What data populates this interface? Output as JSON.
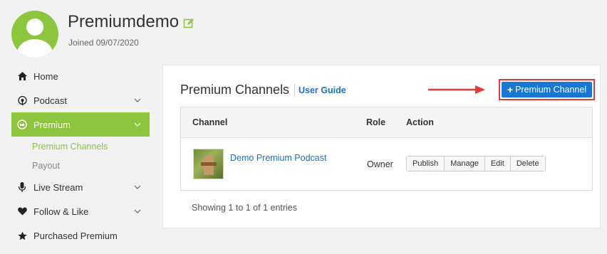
{
  "profile": {
    "username": "Premiumdemo",
    "joined": "Joined 09/07/2020"
  },
  "sidebar": {
    "items": [
      {
        "label": "Home",
        "icon": "home-icon"
      },
      {
        "label": "Podcast",
        "icon": "podcast-icon"
      },
      {
        "label": "Premium",
        "icon": "premium-icon",
        "active": true
      },
      {
        "label": "Live Stream",
        "icon": "microphone-icon"
      },
      {
        "label": "Follow & Like",
        "icon": "heart-icon"
      },
      {
        "label": "Purchased Premium",
        "icon": "star-icon"
      }
    ],
    "subitems": [
      {
        "label": "Premium Channels",
        "active": true
      },
      {
        "label": "Payout"
      }
    ]
  },
  "main": {
    "title": "Premium Channels",
    "user_guide": "User Guide",
    "add_button": "Premium Channel",
    "table": {
      "headers": [
        "Channel",
        "Role",
        "Action"
      ],
      "rows": [
        {
          "channel": "Demo Premium Podcast",
          "role": "Owner",
          "actions": [
            "Publish",
            "Manage",
            "Edit",
            "Delete"
          ]
        }
      ]
    },
    "showing": "Showing 1 to 1 of 1 entries"
  },
  "colors": {
    "accent": "#8cc63f",
    "link": "#1a73c2",
    "primary_button": "#1976d2",
    "highlight": "#e53935"
  }
}
